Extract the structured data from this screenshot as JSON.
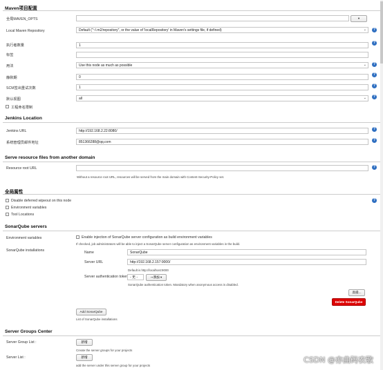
{
  "maven": {
    "title": "Maven项目配置",
    "global_opts_label": "全局MAVEN_OPTS",
    "local_repo_label": "Local Maven Repository",
    "local_repo_value": "Default (\"~/.m2/repository\", or the value of 'localRepository' in Maven's settings file, if defined)",
    "executors_label": "执行者数量",
    "executors_value": "1",
    "labels_label": "标签",
    "labels_value": "",
    "usage_label": "用法",
    "usage_value": "Use this node as much as possible",
    "quiet_label": "静默期",
    "quiet_value": "0",
    "scm_label": "SCM签出重试次数",
    "scm_value": "1",
    "default_view_label": "默认视图",
    "default_view_value": "all",
    "project_naming_label": "工程命名限制"
  },
  "jenkins_location": {
    "title": "Jenkins Location",
    "url_label": "Jenkins URL",
    "url_value": "http://192.168.2.22:8080/",
    "email_label": "系统管理员邮件地址",
    "email_value": "851366288@qq.com"
  },
  "resource_files": {
    "title": "Serve resource files from another domain",
    "root_url_label": "Resource root URL",
    "root_url_value": "",
    "root_url_desc": "Without a resource root URL, resources will be served from the main domain with Content-Security-Policy set."
  },
  "global_props": {
    "title": "全局属性",
    "opt1": "Disable deferred wipeout on this node",
    "opt2": "Environment variables",
    "opt3": "Tool Locations"
  },
  "sonar": {
    "title": "SonarQube servers",
    "env_label": "Environment variables",
    "env_checkbox": "Enable injection of SonarQube server configuration as build environment variables",
    "env_desc": "If checked, job administrators will be able to inject a SonarQube server configuration as environment variables in the build.",
    "installations_label": "SonarQube installations",
    "name_label": "Name",
    "name_value": "SonarQube",
    "server_url_label": "Server URL",
    "server_url_value": "http://192.168.2.157:9000/",
    "server_url_hint": "Default is http://localhost:9000",
    "token_label": "Server authentication token",
    "token_select": "- 无 -",
    "add_button": "添加",
    "token_desc": "SonarQube authentication token. Mandatory when anonymous access is disabled.",
    "advanced_button": "高级...",
    "delete_button": "Delete SonarQube",
    "add_sonar_button": "Add SonarQube",
    "list_desc": "List of SonarQube installations"
  },
  "server_groups": {
    "title": "Server Groups Center",
    "group_list_label": "Server Group List :",
    "group_add_button": "新增",
    "group_desc": "Create the server groups for your projects",
    "server_list_label": "Server List :",
    "server_add_button": "新增",
    "server_desc": "add the server under this server group for your projects"
  },
  "watermark": "CSDN @亦曲码农歌",
  "icons": {
    "help": "help-icon",
    "dropdown": "chevron-down-icon",
    "key": "key-icon"
  },
  "colors": {
    "help_blue": "#2f6fc1",
    "delete_red": "#dd0000"
  }
}
